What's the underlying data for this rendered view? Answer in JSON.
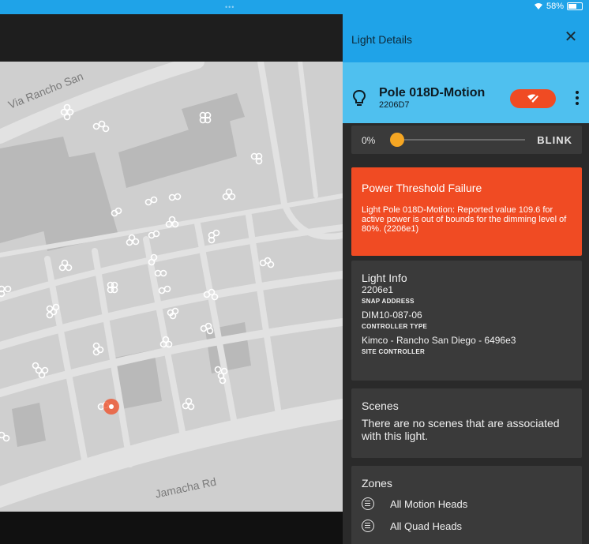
{
  "status_bar": {
    "battery": "58%",
    "dots": "•••"
  },
  "map": {
    "streets": [
      "Via Rancho San",
      "Jamacha Rd"
    ]
  },
  "panel": {
    "title": "Light Details",
    "close_icon": "close-icon",
    "light": {
      "name": "Pole 018D-Motion",
      "id": "2206D7",
      "toggle_color": "#f04b23"
    },
    "dimmer": {
      "percent_label": "0%",
      "level": 0,
      "blink_label": "BLINK"
    },
    "alert": {
      "title": "Power Threshold Failure",
      "body": "Light Pole 018D-Motion: Reported value 109.6 for active power is out of bounds for the dimming level of 80%. (2206e1)",
      "color": "#f04b23"
    },
    "light_info": {
      "title": "Light Info",
      "rows": [
        {
          "value": "2206e1",
          "label": "SNAP ADDRESS"
        },
        {
          "value": "DIM10-087-06",
          "label": "CONTROLLER TYPE"
        },
        {
          "value": "Kimco - Rancho San Diego - 6496e3",
          "label": "SITE CONTROLLER"
        }
      ]
    },
    "scenes": {
      "title": "Scenes",
      "text": "There are no scenes that are associated with this light."
    },
    "zones": {
      "title": "Zones",
      "items": [
        "All Motion Heads",
        "All Quad Heads"
      ]
    }
  },
  "colors": {
    "accent": "#1fa3e8",
    "header_light": "#4fc0ef",
    "slider_thumb": "#f5a623"
  }
}
